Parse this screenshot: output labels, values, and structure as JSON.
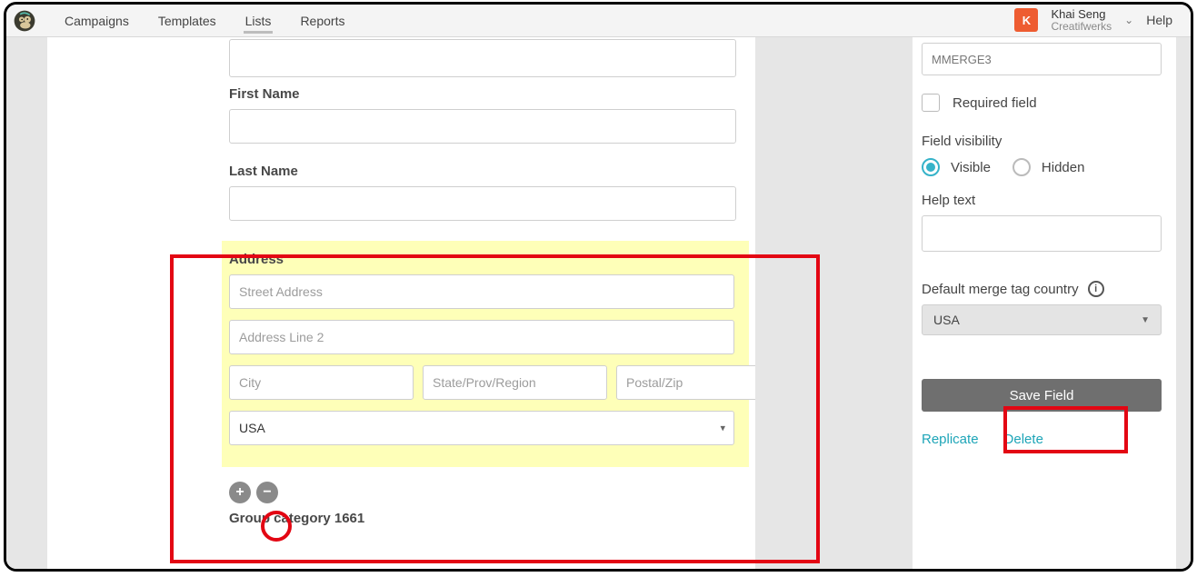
{
  "nav": {
    "items": [
      "Campaigns",
      "Templates",
      "Lists",
      "Reports"
    ]
  },
  "user": {
    "initial": "K",
    "name": "Khai Seng",
    "org": "Creatifwerks",
    "help": "Help"
  },
  "form": {
    "first_name_label": "First Name",
    "last_name_label": "Last Name",
    "address_label": "Address",
    "street_ph": "Street Address",
    "line2_ph": "Address Line 2",
    "city_ph": "City",
    "state_ph": "State/Prov/Region",
    "zip_ph": "Postal/Zip",
    "country_selected": "USA",
    "group_category": "Group category 1661"
  },
  "sidebar": {
    "top_field_value": "MMERGE3",
    "required_label": "Required field",
    "visibility_title": "Field visibility",
    "visible_label": "Visible",
    "hidden_label": "Hidden",
    "help_text_title": "Help text",
    "merge_tag_label": "Default merge tag country",
    "merge_tag_value": "USA",
    "save_label": "Save Field",
    "replicate_label": "Replicate",
    "delete_label": "Delete"
  }
}
